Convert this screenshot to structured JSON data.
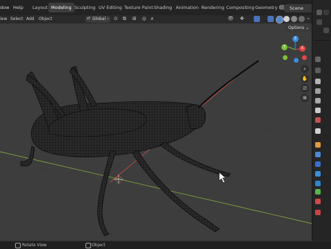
{
  "menu": {
    "window_label": "dow",
    "help_label": "Help"
  },
  "workspaces": [
    {
      "label": "Layout",
      "active": false
    },
    {
      "label": "Modeling",
      "active": true
    },
    {
      "label": "Sculpting",
      "active": false
    },
    {
      "label": "UV Editing",
      "active": false
    },
    {
      "label": "Texture Paint",
      "active": false
    },
    {
      "label": "Shading",
      "active": false
    },
    {
      "label": "Animation",
      "active": false
    },
    {
      "label": "Rendering",
      "active": false
    },
    {
      "label": "Compositing",
      "active": false
    },
    {
      "label": "Geometry N",
      "active": false
    }
  ],
  "scene": {
    "label": "Scene"
  },
  "header": {
    "view": "iew",
    "select": "Select",
    "add": "Add",
    "object": "Object",
    "orientation": "Global",
    "options": "Options"
  },
  "status": {
    "left": "Rotate View",
    "middle": "Object"
  },
  "colors": {
    "x_axis": "#c94a4a",
    "y_axis": "#7ea33a",
    "gizmo_x": "#e04848",
    "gizmo_y": "#7fbf3a",
    "gizmo_z": "#3a8ee0",
    "active_tab": "#3d3d3d"
  }
}
